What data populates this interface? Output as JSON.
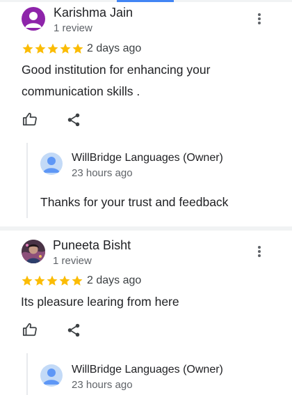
{
  "reviews": [
    {
      "author": "Karishma Jain",
      "meta": "1 review",
      "rating": 5,
      "date": "2 days ago",
      "text": "Good institution for enhancing your communication skills .",
      "owner_reply": {
        "name": "WillBridge Languages (Owner)",
        "time": "23 hours ago",
        "text": "Thanks for your trust and feedback"
      }
    },
    {
      "author": "Puneeta Bisht",
      "meta": "1 review",
      "rating": 5,
      "date": "2 days ago",
      "text": "Its pleasure learing from here",
      "owner_reply": {
        "name": "WillBridge Languages (Owner)",
        "time": "23 hours ago",
        "text": ""
      }
    }
  ],
  "colors": {
    "star": "#fbbc04",
    "accent": "#4285f4",
    "avatar_k": "#8e24aa"
  },
  "icons": [
    "more-vert-icon",
    "thumbs-up-icon",
    "share-icon",
    "person-icon",
    "star-icon"
  ]
}
